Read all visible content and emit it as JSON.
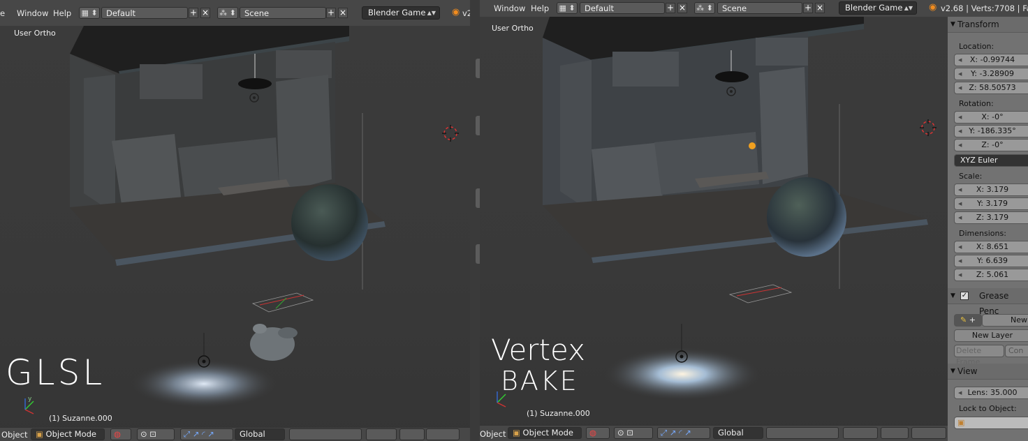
{
  "menu": {
    "file_partial": "e",
    "window": "Window",
    "help": "Help"
  },
  "layout_field": "Default",
  "scene_field": "Scene",
  "engine": "Blender Game",
  "version_left": "v2",
  "version_right": "v2.68 | Verts:7708 | Fa",
  "left_view": {
    "view_label": "User Ortho",
    "object_label": "(1) Suzanne.000",
    "annotation": "GLSL"
  },
  "right_view": {
    "view_label": "User Ortho",
    "object_label": "(1) Suzanne.000",
    "annotation_line1": "Vertex",
    "annotation_line2": "BAKE"
  },
  "bottom": {
    "object_menu_left": "Object",
    "object_menu_right": "Object",
    "mode": "Object Mode",
    "orientation": "Global"
  },
  "properties": {
    "transform_header": "Transform",
    "location_label": "Location:",
    "loc_x": "X: -0.99744",
    "loc_y": "Y: -3.28909",
    "loc_z": "Z: 58.50573",
    "rotation_label": "Rotation:",
    "rot_x": "X: -0°",
    "rot_y": "Y: -186.335°",
    "rot_z": "Z: -0°",
    "rotation_mode": "XYZ Euler",
    "scale_label": "Scale:",
    "scale_x": "X: 3.179",
    "scale_y": "Y: 3.179",
    "scale_z": "Z: 3.179",
    "dimensions_label": "Dimensions:",
    "dim_x": "X: 8.651",
    "dim_y": "Y: 6.639",
    "dim_z": "Z: 5.061",
    "grease_header": "Grease Penc",
    "new_button": "New",
    "new_layer": "New Layer",
    "delete_frame": "Delete Frame",
    "convert_partial": "Con",
    "view_header": "View",
    "lens": "Lens: 35.000",
    "lock_label": "Lock to Object:"
  }
}
